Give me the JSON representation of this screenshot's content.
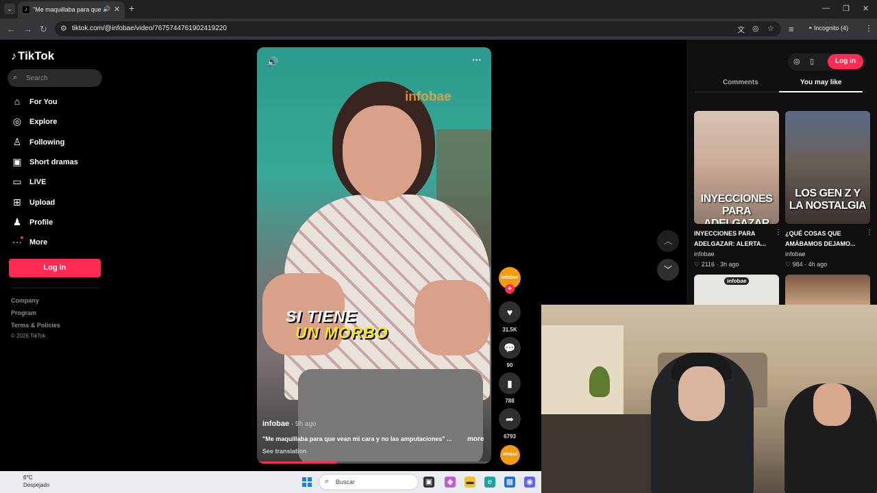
{
  "browser": {
    "tab_title": "\"Me maquillaba para que v",
    "url": "tiktok.com/@infobae/video/7675744761902419220",
    "incognito_label": "Incognito (4)"
  },
  "sidebar": {
    "logo": "TikTok",
    "search_placeholder": "Search",
    "items": [
      {
        "label": "For You",
        "icon": "home-icon"
      },
      {
        "label": "Explore",
        "icon": "compass-icon"
      },
      {
        "label": "Following",
        "icon": "following-icon"
      },
      {
        "label": "Short dramas",
        "icon": "film-icon"
      },
      {
        "label": "LIVE",
        "icon": "live-icon"
      },
      {
        "label": "Upload",
        "icon": "upload-icon"
      },
      {
        "label": "Profile",
        "icon": "profile-icon"
      },
      {
        "label": "More",
        "icon": "more-icon"
      }
    ],
    "login_label": "Log in",
    "footer": [
      "Company",
      "Program",
      "Terms & Policies"
    ],
    "copyright": "© 2026 TikTok"
  },
  "video": {
    "watermark": "infobae",
    "caption_line1": "SI TIENE",
    "caption_line2": "UN MORBO",
    "author": "infobae",
    "time_ago": " · 9h ago",
    "description": "\"Me maquillaba para que vean mi cara y no las amputaciones\" ...",
    "more_label": "more",
    "translate_label": "See translation",
    "progress_fraction": 0.34
  },
  "actions": {
    "avatar_label": "infobae",
    "likes": "31.5K",
    "comments": "90",
    "saves": "788",
    "shares": "6793"
  },
  "right_panel": {
    "login_label": "Log in",
    "tab_comments": "Comments",
    "tab_you_may_like": "You may like",
    "cards": [
      {
        "thumb_text": "INYECCIONES PARA ADELGAZAR",
        "title": "INYECCIONES PARA ADELGAZAR: ALERTA...",
        "author": "infobae",
        "likes": "2116",
        "ago": "3h ago"
      },
      {
        "thumb_text": "LOS GEN Z Y LA NOSTALGIA",
        "title": "¿QUÉ COSAS QUE AMÁBAMOS DEJAMO...",
        "author": "infobae",
        "likes": "984",
        "ago": "4h ago"
      }
    ],
    "card3_badge": "infobae"
  },
  "taskbar": {
    "temp": "6°C",
    "weather": "Despejado",
    "search_placeholder": "Buscar"
  },
  "colors": {
    "accent": "#fe2c55",
    "avatar": "#f39c12",
    "caption_yellow": "#f7e41d"
  }
}
